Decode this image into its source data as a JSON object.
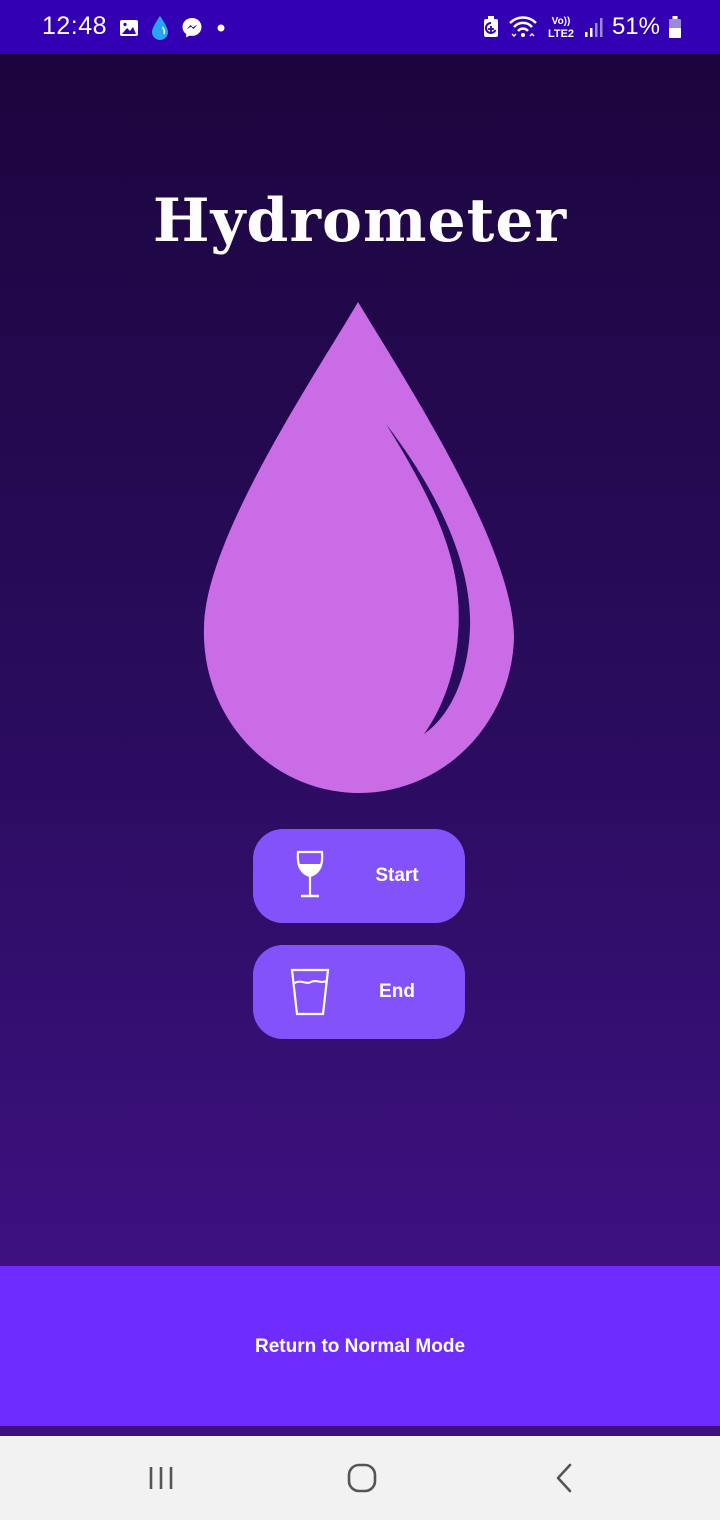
{
  "status_bar": {
    "time": "12:48",
    "battery_percent": "51%",
    "left_icons": [
      "gallery-icon",
      "water-drop-icon",
      "messenger-icon",
      "dot-icon"
    ],
    "right_icons": [
      "battery-saver-icon",
      "wifi-icon",
      "volte-lte2-icon",
      "signal-icon",
      "battery-icon"
    ],
    "network_label_top": "Vo))",
    "network_label_bottom": "LTE2"
  },
  "app": {
    "title": "Hydrometer",
    "buttons": {
      "start_label": "Start",
      "start_icon": "wine-glass-icon",
      "end_label": "End",
      "end_icon": "water-glass-icon"
    },
    "bottom_bar_label": "Return to Normal Mode"
  },
  "nav_bar": {
    "items": [
      "recents-icon",
      "home-icon",
      "back-icon"
    ]
  },
  "colors": {
    "status_bar": "#3300b3",
    "drop": "#c96ce6",
    "button": "#8452fa",
    "bottom_bar": "#6f2cff",
    "nav_bar": "#f2f2f2"
  }
}
